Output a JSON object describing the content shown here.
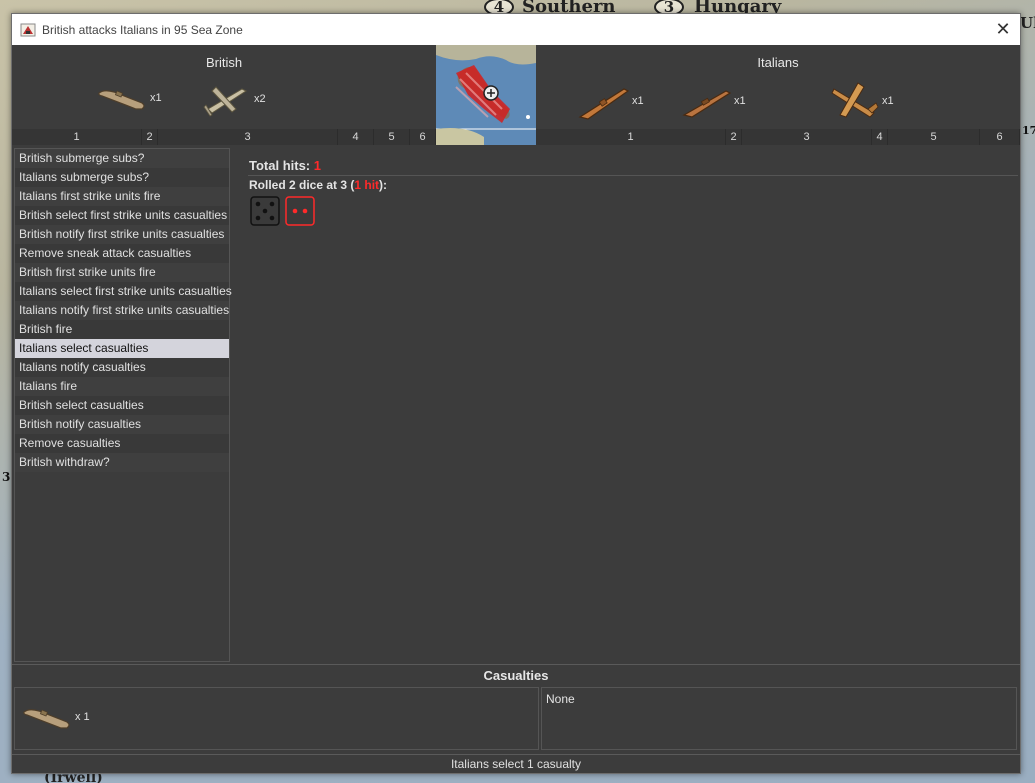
{
  "window": {
    "title": "British attacks Italians in 95 Sea Zone",
    "close_label": "✕"
  },
  "background_map": {
    "labels": [
      "Southern",
      "Hungary",
      "(Irwell)"
    ],
    "badges": [
      "4",
      "3",
      "3",
      "17"
    ],
    "fragment": "Uk"
  },
  "attacker": {
    "name": "British",
    "units": [
      {
        "icon": "submarine-icon",
        "count": "x1"
      },
      {
        "icon": "bomber-icon",
        "count": "x2"
      }
    ],
    "ruler": [
      "1",
      "2",
      "3",
      "4",
      "5",
      "6"
    ]
  },
  "defender": {
    "name": "Italians",
    "units": [
      {
        "icon": "destroyer-icon",
        "count": "x1"
      },
      {
        "icon": "cruiser-icon",
        "count": "x1"
      },
      {
        "icon": "fighter-icon",
        "count": "x1"
      }
    ],
    "ruler": [
      "1",
      "2",
      "3",
      "4",
      "5",
      "6"
    ]
  },
  "steps": [
    "British submerge subs?",
    "Italians submerge subs?",
    "Italians first strike units fire",
    "British select first strike units casualties",
    "British notify first strike units casualties",
    "Remove sneak attack casualties",
    "British first strike units fire",
    "Italians select first strike units casualties",
    "Italians notify first strike units casualties",
    "British fire",
    "Italians select casualties",
    "Italians notify casualties",
    "Italians fire",
    "British select casualties",
    "British notify casualties",
    "Remove casualties",
    "British withdraw?"
  ],
  "selected_step": 10,
  "results": {
    "total_hits_label": "Total hits:",
    "total_hits_value": "1",
    "roll_prefix": "Rolled 2 dice at 3 (",
    "roll_hits": "1 hit",
    "roll_suffix": "):",
    "dice": [
      {
        "value": 5,
        "hit": false
      },
      {
        "value": 2,
        "hit": true
      }
    ]
  },
  "casualties": {
    "title": "Casualties",
    "left_unit_icon": "submarine-icon",
    "left_count": "x 1",
    "right_text": "None"
  },
  "status": "Italians select 1 casualty",
  "colors": {
    "hit_red": "#ff2a2a",
    "panel_bg": "#3c3c3c",
    "selected_row": "#d4d4dc"
  }
}
